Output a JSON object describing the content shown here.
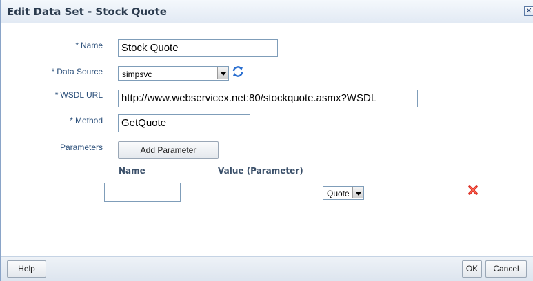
{
  "dialog": {
    "title": "Edit Data Set - Stock Quote"
  },
  "form": {
    "name": {
      "label": "Name",
      "value": "Stock Quote",
      "required": "*"
    },
    "data_source": {
      "label": "Data Source",
      "value": "simpsvc",
      "required": "*"
    },
    "wsdl_url": {
      "label": "WSDL URL",
      "value": "http://www.webservicex.net:80/stockquote.asmx?WSDL",
      "required": "*"
    },
    "method": {
      "label": "Method",
      "value": "GetQuote",
      "required": "*"
    },
    "parameters": {
      "label": "Parameters",
      "add_button": "Add Parameter"
    }
  },
  "param_table": {
    "headers": [
      "Name",
      "Value (Parameter)"
    ],
    "rows": [
      {
        "name": "",
        "value": "Quote"
      }
    ]
  },
  "footer": {
    "help": "Help",
    "ok": "OK",
    "cancel": "Cancel"
  },
  "icons": {
    "close": "close-icon",
    "refresh": "refresh-icon",
    "delete": "delete-icon",
    "dropdown": "chevron-down-icon"
  },
  "colors": {
    "label": "#2b4f7a",
    "delete_red": "#d9261c",
    "refresh_blue": "#2a6fd0"
  }
}
